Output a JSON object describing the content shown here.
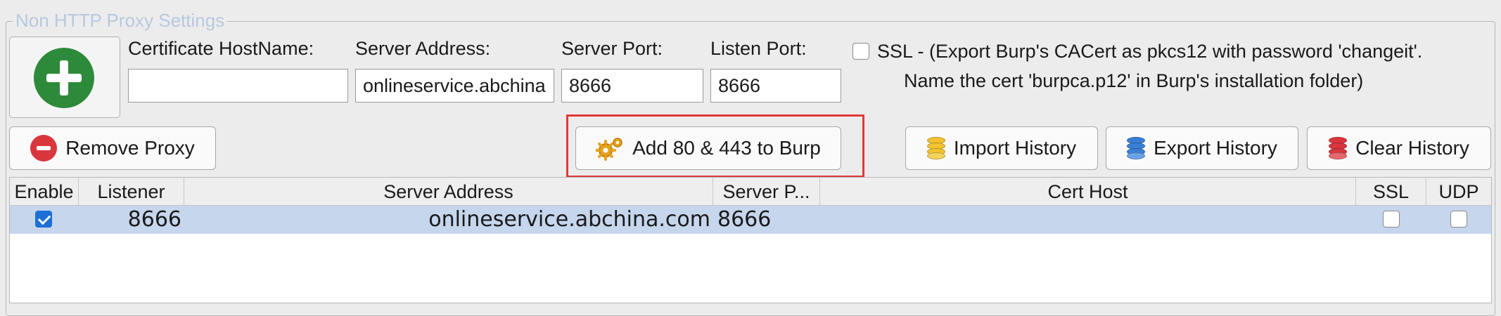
{
  "group_title": "Non HTTP Proxy Settings",
  "form": {
    "cert_hostname_label": "Certificate  HostName:",
    "cert_hostname_value": "",
    "server_address_label": "Server Address:",
    "server_address_value": "onlineservice.abchina",
    "server_port_label": "Server Port:",
    "server_port_value": "8666",
    "listen_port_label": "Listen Port:",
    "listen_port_value": "8666",
    "ssl_checked": false,
    "ssl_line1": "SSL - (Export Burp's CACert as pkcs12 with  password 'changeit'.",
    "ssl_line2": "Name the cert 'burpca.p12'  in Burp's installation folder)"
  },
  "buttons": {
    "remove_proxy": "Remove Proxy",
    "add_80_443": "Add 80 & 443 to Burp",
    "import_history": "Import History",
    "export_history": "Export History",
    "clear_history": "Clear History"
  },
  "icons": {
    "add": "plus-circle-icon",
    "remove": "minus-circle-icon",
    "gears": "gears-icon",
    "import": "database-yellow-icon",
    "export": "database-blue-icon",
    "clear": "database-red-icon"
  },
  "colors": {
    "add_green": "#2d8a3a",
    "remove_red": "#d9363e",
    "highlight": "#e03a36",
    "selected_row": "#c5d6ed"
  },
  "table": {
    "columns": [
      "Enable",
      "Listener",
      "Server Address",
      "Server P...",
      "Cert Host",
      "SSL",
      "UDP"
    ],
    "rows": [
      {
        "enable": true,
        "listener": "8666",
        "server_address": "onlineservice.abchina.com",
        "server_port": "8666",
        "cert_host": "",
        "ssl": false,
        "udp": false
      }
    ]
  }
}
